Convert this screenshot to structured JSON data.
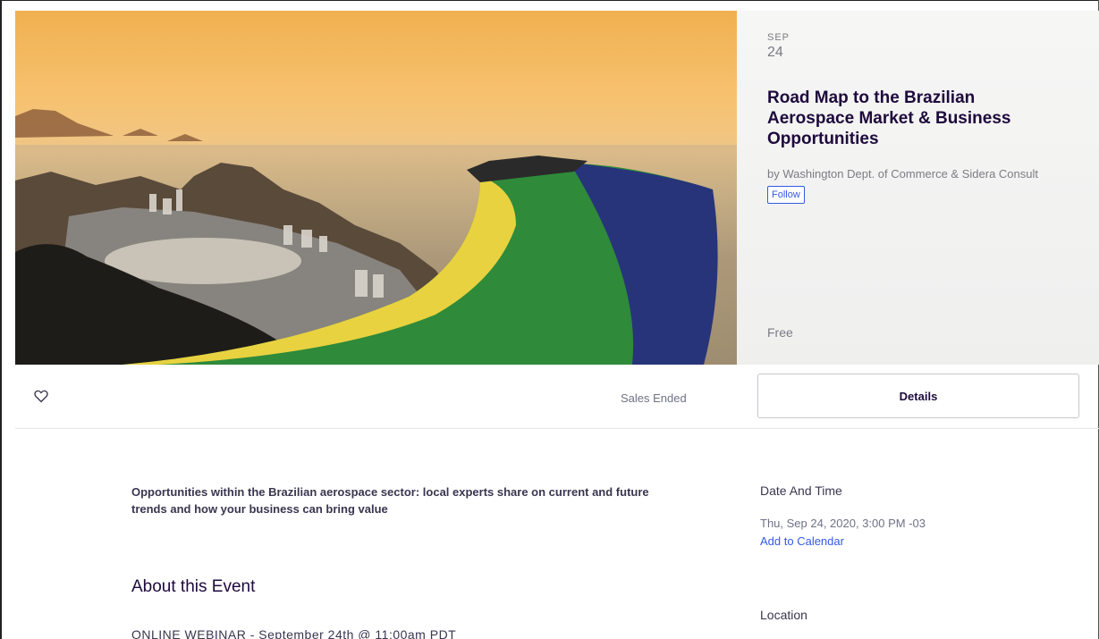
{
  "event": {
    "month": "SEP",
    "day": "24",
    "title": "Road Map to the Brazilian Aerospace Market & Business Opportunities",
    "organizer": "by Washington Dept. of Commerce & Sidera Consult",
    "follow_label": "Follow",
    "price": "Free"
  },
  "actions": {
    "sales_status": "Sales Ended",
    "details_label": "Details"
  },
  "body": {
    "summary": "Opportunities within the Brazilian aerospace sector: local experts share on current and future trends and how your business can bring value",
    "about_heading": "About this Event",
    "webinar_line": "ONLINE WEBINAR - September 24th @ 11:00am PDT"
  },
  "sidebar": {
    "date_heading": "Date And Time",
    "date_value": "Thu, Sep 24, 2020, 3:00 PM -03",
    "add_calendar": "Add to Calendar",
    "location_heading": "Location"
  },
  "colors": {
    "accent": "#3659e3",
    "title": "#1e0a3c",
    "muted": "#6f7287"
  },
  "icons": [
    "heart-icon"
  ]
}
